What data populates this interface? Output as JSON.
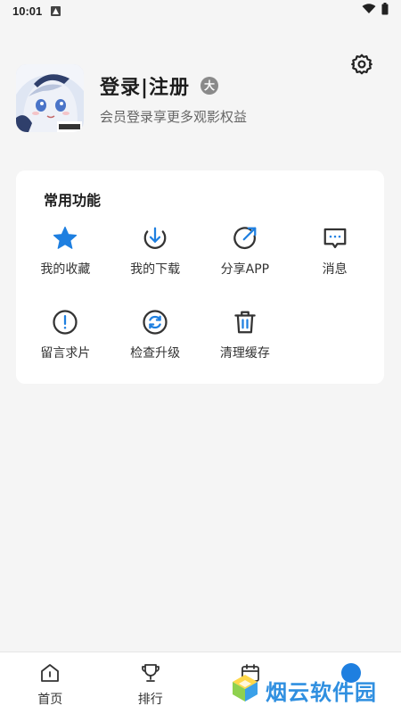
{
  "status_bar": {
    "time": "10:01"
  },
  "profile": {
    "title": "登录|注册",
    "badge": "大",
    "subtitle": "会员登录享更多观影权益"
  },
  "functions": {
    "title": "常用功能",
    "items": [
      {
        "label": "我的收藏",
        "icon": "star-icon"
      },
      {
        "label": "我的下载",
        "icon": "download-icon"
      },
      {
        "label": "分享APP",
        "icon": "share-icon"
      },
      {
        "label": "消息",
        "icon": "message-icon"
      },
      {
        "label": "留言求片",
        "icon": "exclamation-icon"
      },
      {
        "label": "检查升级",
        "icon": "refresh-icon"
      },
      {
        "label": "清理缓存",
        "icon": "trash-icon"
      }
    ]
  },
  "tabbar": {
    "items": [
      {
        "label": "首页",
        "icon": "home-icon"
      },
      {
        "label": "排行",
        "icon": "trophy-icon"
      },
      {
        "label": "",
        "icon": "calendar-icon"
      },
      {
        "label": "",
        "icon": "profile-icon"
      }
    ]
  },
  "watermark": {
    "text": "烟云软件园"
  },
  "colors": {
    "accent": "#1e7fe0",
    "background": "#f5f5f5",
    "card": "#ffffff"
  }
}
